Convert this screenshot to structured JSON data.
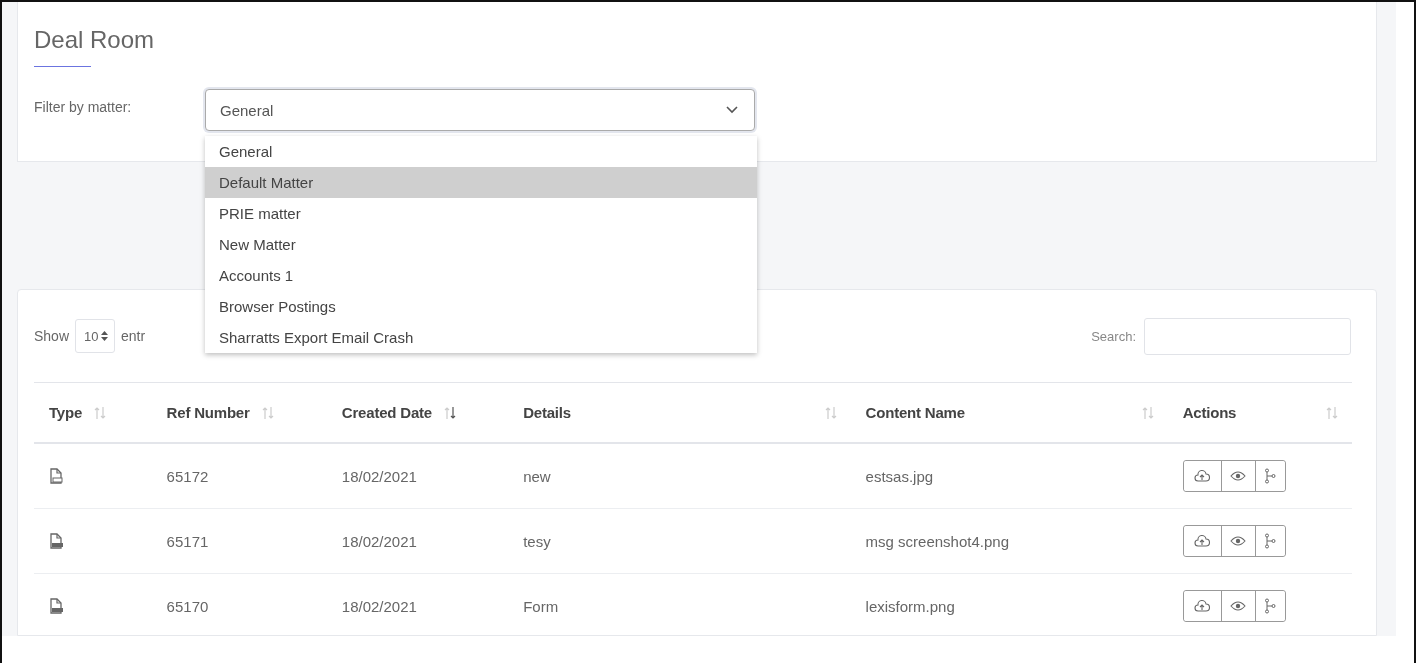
{
  "page": {
    "title": "Deal Room"
  },
  "filter": {
    "label": "Filter by matter:",
    "value": "General",
    "expanded": true,
    "options": [
      {
        "label": "General",
        "highlighted": false
      },
      {
        "label": "Default Matter",
        "highlighted": true
      },
      {
        "label": "PRIE matter",
        "highlighted": false
      },
      {
        "label": "New Matter",
        "highlighted": false
      },
      {
        "label": "Accounts 1",
        "highlighted": false
      },
      {
        "label": "Browser Postings",
        "highlighted": false
      },
      {
        "label": "Sharratts Export Email Crash",
        "highlighted": false
      }
    ]
  },
  "length": {
    "label": "Show",
    "value": "10",
    "suffix": "entr"
  },
  "search": {
    "label": "Search:"
  },
  "table": {
    "columns": [
      {
        "label": "Type",
        "sorted": false
      },
      {
        "label": "Ref Number",
        "sorted": false
      },
      {
        "label": "Created Date",
        "sorted": true
      },
      {
        "label": "Details",
        "sorted": false
      },
      {
        "label": "Content Name",
        "sorted": false
      },
      {
        "label": "Actions",
        "sorted": false
      }
    ],
    "rows": [
      {
        "kind": "jpg",
        "ref": "65172",
        "date": "18/02/2021",
        "details": "new",
        "content": "estsas.jpg"
      },
      {
        "kind": "png",
        "ref": "65171",
        "date": "18/02/2021",
        "details": "tesy",
        "content": "msg screenshot4.png"
      },
      {
        "kind": "png",
        "ref": "65170",
        "date": "18/02/2021",
        "details": "Form",
        "content": "lexisform.png"
      }
    ]
  }
}
